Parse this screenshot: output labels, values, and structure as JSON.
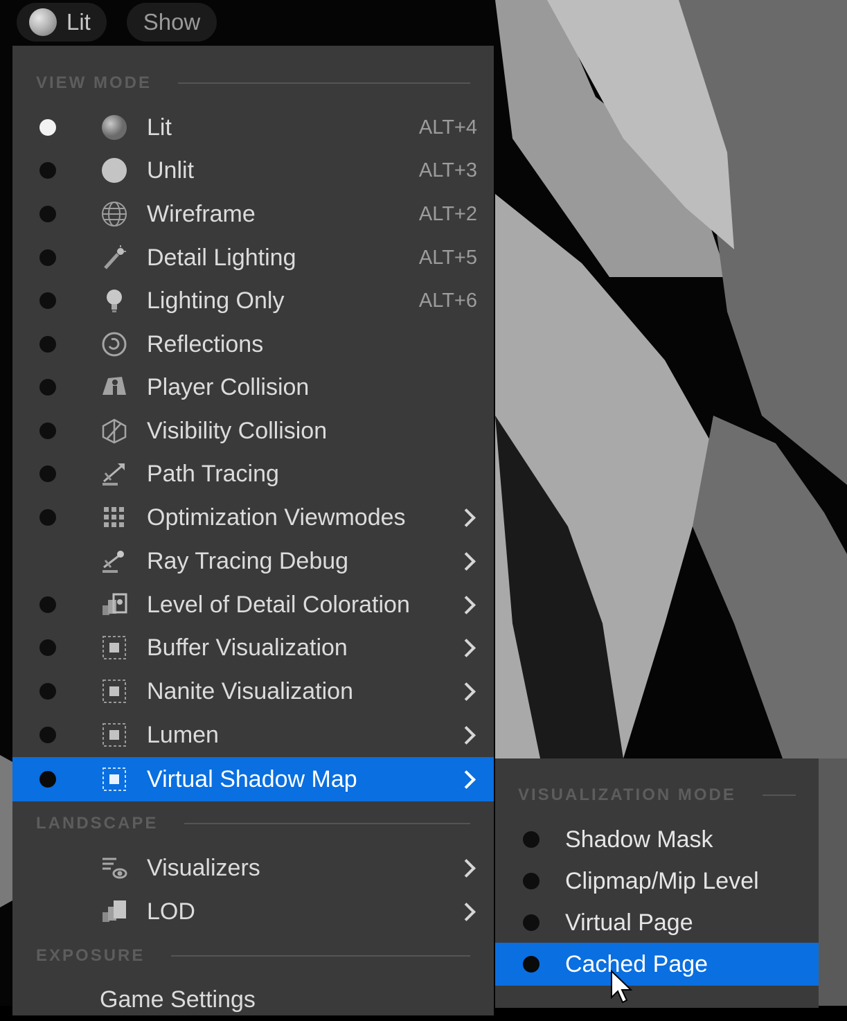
{
  "toolbar": {
    "view_mode_button": "Lit",
    "show_button": "Show"
  },
  "menu": {
    "view_mode_header": "VIEW MODE",
    "items": [
      {
        "label": "Lit",
        "shortcut": "ALT+4",
        "icon": "lit-sphere-icon"
      },
      {
        "label": "Unlit",
        "shortcut": "ALT+3",
        "icon": "unlit-sphere-icon"
      },
      {
        "label": "Wireframe",
        "shortcut": "ALT+2",
        "icon": "wireframe-sphere-icon"
      },
      {
        "label": "Detail Lighting",
        "shortcut": "ALT+5",
        "icon": "detail-lighting-icon"
      },
      {
        "label": "Lighting Only",
        "shortcut": "ALT+6",
        "icon": "lightbulb-icon"
      },
      {
        "label": "Reflections",
        "icon": "reflections-icon"
      },
      {
        "label": "Player Collision",
        "icon": "player-collision-icon"
      },
      {
        "label": "Visibility Collision",
        "icon": "visibility-collision-icon"
      },
      {
        "label": "Path Tracing",
        "icon": "path-tracing-icon"
      },
      {
        "label": "Optimization Viewmodes",
        "icon": "grid-icon"
      },
      {
        "label": "Ray Tracing Debug",
        "icon": "ray-tracing-icon"
      },
      {
        "label": "Level of Detail Coloration",
        "icon": "lod-coloration-icon"
      },
      {
        "label": "Buffer Visualization",
        "icon": "buffer-visualization-icon"
      },
      {
        "label": "Nanite Visualization",
        "icon": "nanite-visualization-icon"
      },
      {
        "label": "Lumen",
        "icon": "lumen-icon"
      },
      {
        "label": "Virtual Shadow Map",
        "icon": "virtual-shadow-map-icon"
      }
    ],
    "landscape_header": "LANDSCAPE",
    "landscape_items": [
      {
        "label": "Visualizers",
        "icon": "visualizers-icon"
      },
      {
        "label": "LOD",
        "icon": "lod-icon"
      }
    ],
    "exposure_header": "EXPOSURE",
    "exposure_items": [
      {
        "label": "Game Settings"
      }
    ]
  },
  "submenu": {
    "header": "VISUALIZATION MODE",
    "items": [
      {
        "label": "Shadow Mask"
      },
      {
        "label": "Clipmap/Mip Level"
      },
      {
        "label": "Virtual Page"
      },
      {
        "label": "Cached Page"
      }
    ]
  },
  "colors": {
    "menu_bg": "#3a3a3a",
    "highlight": "#0a6fe0",
    "section_text": "#5d5d5d"
  }
}
